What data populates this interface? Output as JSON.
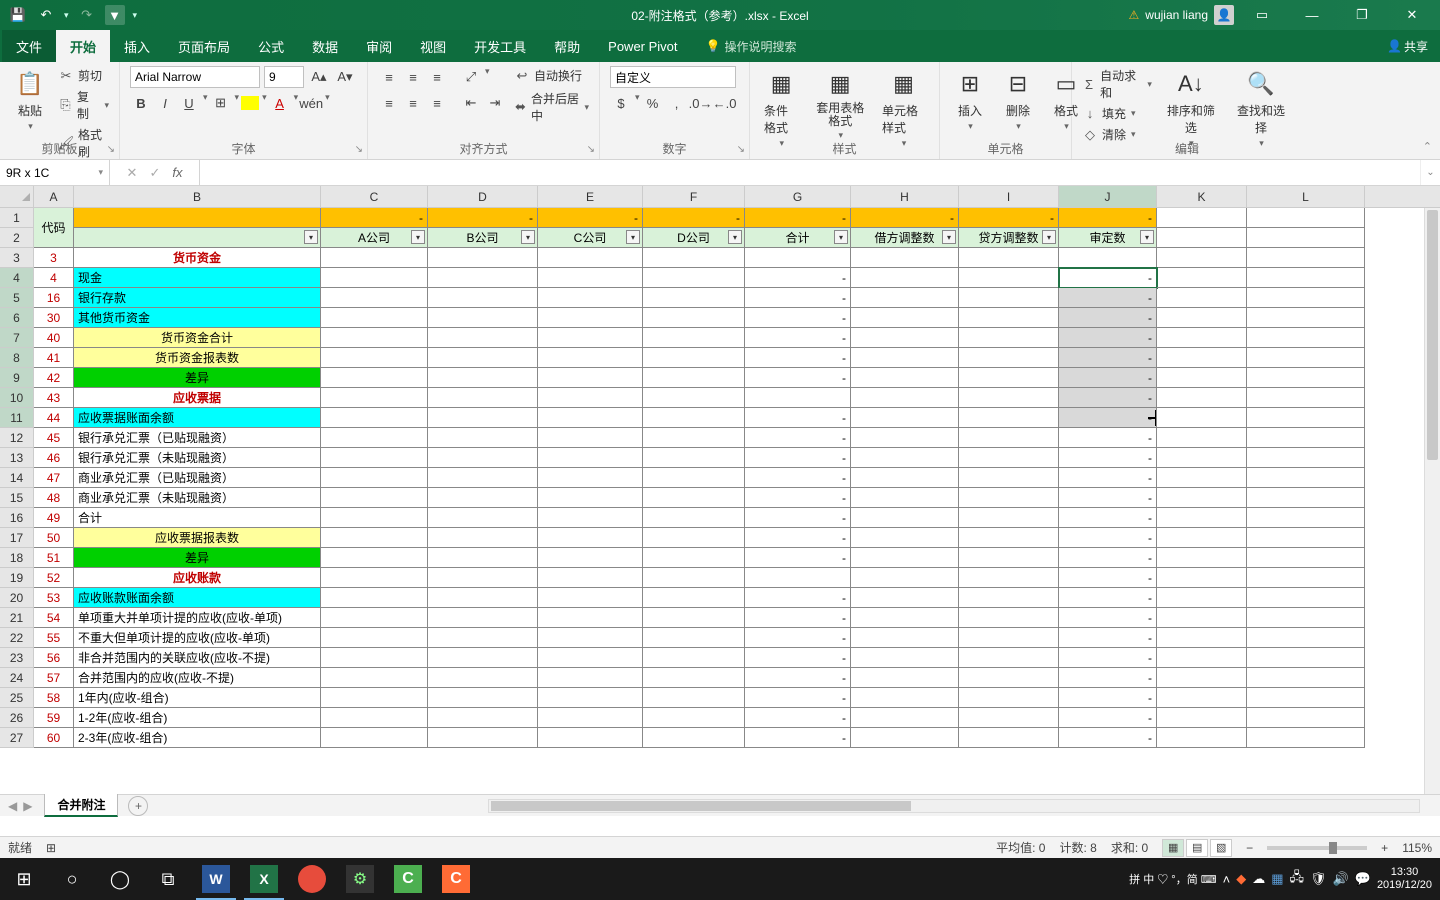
{
  "title_bar": {
    "filename": "02-附注格式（参考）.xlsx - Excel",
    "user_warn_icon": "⚠",
    "username": "wujian liang",
    "qat": {
      "save": "💾",
      "undo": "↶",
      "redo": "↷",
      "funnel": "▲",
      "more": "▾"
    },
    "win": {
      "ribbon": "▭",
      "min": "—",
      "restore": "❐",
      "close": "✕"
    }
  },
  "ribbon": {
    "tabs": [
      "文件",
      "开始",
      "插入",
      "页面布局",
      "公式",
      "数据",
      "审阅",
      "视图",
      "开发工具",
      "帮助",
      "Power Pivot"
    ],
    "active_tab": "开始",
    "tell_me_icon": "💡",
    "tell_me": "操作说明搜索",
    "share_icon": "👤",
    "share": "共享"
  },
  "groups": {
    "clipboard": {
      "paste": "粘贴",
      "cut": "剪切",
      "copy": "复制",
      "format_painter": "格式刷",
      "label": "剪贴板"
    },
    "font": {
      "name": "Arial Narrow",
      "size": "9",
      "bold": "B",
      "italic": "I",
      "underline": "U",
      "label": "字体"
    },
    "align": {
      "wrap": "自动换行",
      "merge": "合并后居中",
      "label": "对齐方式"
    },
    "number": {
      "format": "自定义",
      "label": "数字"
    },
    "styles": {
      "cond": "条件格式",
      "table": "套用表格格式",
      "cell": "单元格样式",
      "label": "样式"
    },
    "cells": {
      "insert": "插入",
      "delete": "删除",
      "format": "格式",
      "label": "单元格"
    },
    "editing": {
      "sum": "自动求和",
      "fill": "填充",
      "clear": "清除",
      "sort": "排序和筛选",
      "find": "查找和选择",
      "label": "编辑"
    }
  },
  "namebox": "9R x 1C",
  "columns": [
    "A",
    "B",
    "C",
    "D",
    "E",
    "F",
    "G",
    "H",
    "I",
    "J",
    "K",
    "L"
  ],
  "header_row1": {
    "code_merged": "代码",
    "dashC": "-",
    "dashD": "-",
    "dashE": "-",
    "dashF": "-",
    "dashG": "-",
    "dashH": "-",
    "dashI": "-",
    "dashJ": "-"
  },
  "header_row2": {
    "C": "A公司",
    "D": "B公司",
    "E": "C公司",
    "F": "D公司",
    "G": "合计",
    "H": "借方调整数",
    "I": "贷方调整数",
    "J": "审定数"
  },
  "rows": [
    {
      "n": 3,
      "a": "3",
      "b": "货币资金",
      "cls": "txt-red txt-c",
      "g": "",
      "j": ""
    },
    {
      "n": 4,
      "a": "4",
      "b": "现金",
      "bbg": "bg-cyan",
      "g": "-",
      "j": "-",
      "jsel": true,
      "active": true
    },
    {
      "n": 5,
      "a": "16",
      "b": "银行存款",
      "bbg": "bg-cyan",
      "g": "-",
      "j": "-",
      "jsel": true
    },
    {
      "n": 6,
      "a": "30",
      "b": "其他货币资金",
      "bbg": "bg-cyan",
      "g": "-",
      "j": "-",
      "jsel": true
    },
    {
      "n": 7,
      "a": "40",
      "b": "货币资金合计",
      "bbg": "bg-yellow",
      "bc": "txt-c",
      "g": "-",
      "j": "-",
      "jsel": true
    },
    {
      "n": 8,
      "a": "41",
      "b": "货币资金报表数",
      "bbg": "bg-yellow",
      "bc": "txt-c",
      "g": "-",
      "j": "-",
      "jsel": true
    },
    {
      "n": 9,
      "a": "42",
      "b": "差异",
      "bbg": "bg-green",
      "bc": "txt-c",
      "g": "-",
      "j": "-",
      "jsel": true
    },
    {
      "n": 10,
      "a": "43",
      "b": "应收票据",
      "cls": "txt-red txt-c",
      "g": "",
      "j": "-",
      "jsel": true
    },
    {
      "n": 11,
      "a": "44",
      "b": "应收票据账面余额",
      "bbg": "bg-cyan",
      "g": "-",
      "j": "-",
      "jsel": true,
      "cursor": true
    },
    {
      "n": 12,
      "a": "45",
      "b": "银行承兑汇票（已贴现融资）",
      "g": "-",
      "j": "-"
    },
    {
      "n": 13,
      "a": "46",
      "b": "银行承兑汇票（未贴现融资）",
      "g": "-",
      "j": "-"
    },
    {
      "n": 14,
      "a": "47",
      "b": "商业承兑汇票（已贴现融资）",
      "g": "-",
      "j": "-"
    },
    {
      "n": 15,
      "a": "48",
      "b": "商业承兑汇票（未贴现融资）",
      "g": "-",
      "j": "-"
    },
    {
      "n": 16,
      "a": "49",
      "b": "合计",
      "g": "-",
      "j": "-"
    },
    {
      "n": 17,
      "a": "50",
      "b": "应收票据报表数",
      "bbg": "bg-yellow",
      "bc": "txt-c",
      "g": "-",
      "j": "-"
    },
    {
      "n": 18,
      "a": "51",
      "b": "差异",
      "bbg": "bg-green",
      "bc": "txt-c",
      "g": "-",
      "j": "-"
    },
    {
      "n": 19,
      "a": "52",
      "b": "应收账款",
      "cls": "txt-red txt-c",
      "g": "",
      "j": "-"
    },
    {
      "n": 20,
      "a": "53",
      "b": "应收账款账面余额",
      "bbg": "bg-cyan",
      "g": "-",
      "j": "-"
    },
    {
      "n": 21,
      "a": "54",
      "b": "单项重大并单项计提的应收(应收-单项)",
      "g": "-",
      "j": "-"
    },
    {
      "n": 22,
      "a": "55",
      "b": "不重大但单项计提的应收(应收-单项)",
      "g": "-",
      "j": "-"
    },
    {
      "n": 23,
      "a": "56",
      "b": "非合并范围内的关联应收(应收-不提)",
      "g": "-",
      "j": "-"
    },
    {
      "n": 24,
      "a": "57",
      "b": "合并范围内的应收(应收-不提)",
      "g": "-",
      "j": "-"
    },
    {
      "n": 25,
      "a": "58",
      "b": "1年内(应收-组合)",
      "g": "-",
      "j": "-"
    },
    {
      "n": 26,
      "a": "59",
      "b": "1-2年(应收-组合)",
      "g": "-",
      "j": "-"
    },
    {
      "n": 27,
      "a": "60",
      "b": "2-3年(应收-组合)",
      "g": "-",
      "j": "-"
    }
  ],
  "sheet_tab": "合并附注",
  "status": {
    "ready": "就绪",
    "calc_icon": "⊞",
    "avg": "平均值: 0",
    "count": "计数: 8",
    "sum": "求和: 0",
    "zoom": "115%"
  },
  "taskbar": {
    "ime": "拼 中 ♡ °，简 ⌨",
    "time": "13:30",
    "date": "2019/12/20"
  }
}
